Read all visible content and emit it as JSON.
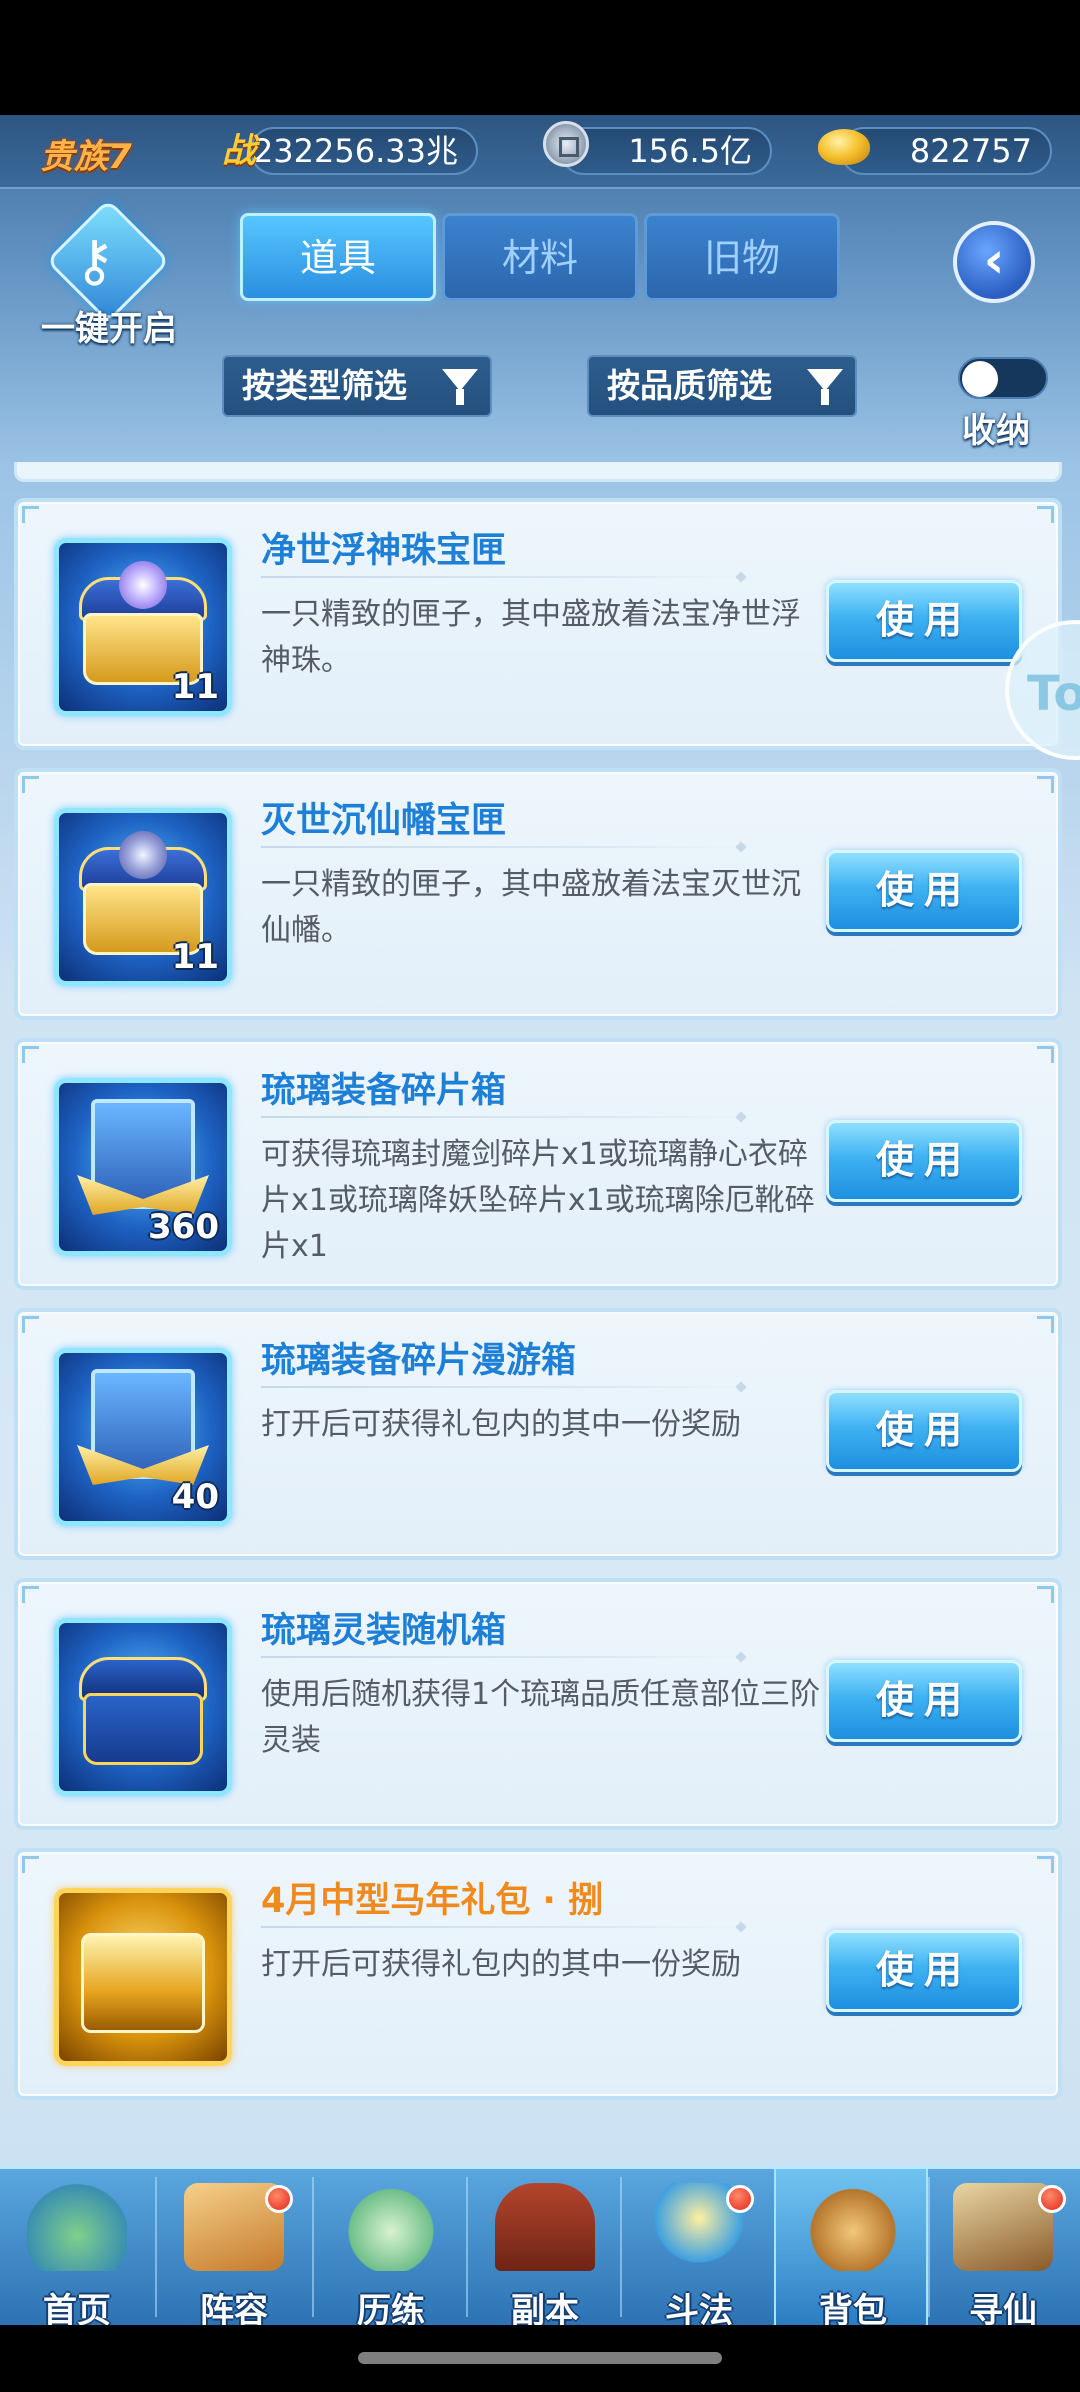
{
  "resources": {
    "rank": "贵族7",
    "power_icon": "战",
    "power": "232256.33兆",
    "coins": "156.5亿",
    "gold": "822757",
    "icons": [
      "power-badge",
      "silver-coin",
      "gold-ingot"
    ]
  },
  "header": {
    "one_click_open": "一键开启",
    "tabs": [
      {
        "label": "道具",
        "active": true
      },
      {
        "label": "材料",
        "active": false
      },
      {
        "label": "旧物",
        "active": false
      }
    ],
    "back_icon": "‹"
  },
  "filters": {
    "by_type": "按类型筛选",
    "by_quality": "按品质筛选",
    "collapse_label": "收纳",
    "collapse_on": false
  },
  "items": [
    {
      "name": "净世浮神珠宝匣",
      "desc": "一只精致的匣子，其中盛放着法宝净世浮神珠。",
      "count": "11",
      "name_color": "#1d7fd6",
      "icon": "treasure-chest-orb"
    },
    {
      "name": "灭世沉仙幡宝匣",
      "desc": "一只精致的匣子，其中盛放着法宝灭世沉仙幡。",
      "count": "11",
      "name_color": "#1d7fd6",
      "icon": "treasure-chest-banner"
    },
    {
      "name": "琉璃装备碎片箱",
      "desc": "可获得琉璃封魔剑碎片x1或琉璃静心衣碎片x1或琉璃降妖坠碎片x1或琉璃除厄靴碎片x1",
      "count": "360",
      "name_color": "#1d7fd6",
      "icon": "equipment-fragment-box"
    },
    {
      "name": "琉璃装备碎片漫游箱",
      "desc": "打开后可获得礼包内的其中一份奖励",
      "count": "40",
      "name_color": "#1d7fd6",
      "icon": "equipment-fragment-box"
    },
    {
      "name": "琉璃灵装随机箱",
      "desc": "使用后随机获得1个琉璃品质任意部位三阶灵装",
      "count": "",
      "name_color": "#1d7fd6",
      "icon": "spirit-gear-chest"
    },
    {
      "name": "4月中型马年礼包 · 捌",
      "desc": "打开后可获得礼包内的其中一份奖励",
      "count": "",
      "name_color": "#f08a1c",
      "icon": "gold-gift-chest"
    }
  ],
  "use_label": "使用",
  "nav": [
    {
      "label": "首页",
      "dot": false,
      "active": false
    },
    {
      "label": "阵容",
      "dot": true,
      "active": false
    },
    {
      "label": "历练",
      "dot": false,
      "active": false
    },
    {
      "label": "副本",
      "dot": false,
      "active": false
    },
    {
      "label": "斗法",
      "dot": true,
      "active": false
    },
    {
      "label": "背包",
      "dot": false,
      "active": true
    },
    {
      "label": "寻仙",
      "dot": true,
      "active": false
    }
  ]
}
